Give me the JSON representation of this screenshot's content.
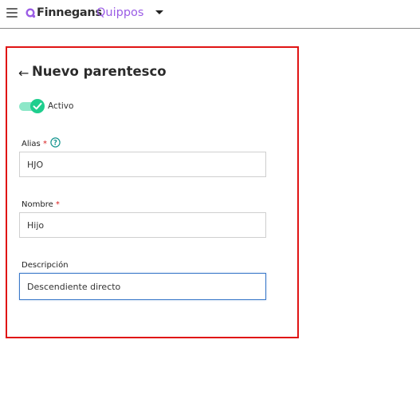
{
  "header": {
    "brand_primary": "Finnegans",
    "brand_secondary": "Quippos",
    "icons": {
      "menu": "hamburger-menu-icon",
      "logo": "finnegans-logo-icon",
      "caret": "caret-down-icon"
    },
    "colors": {
      "brand_secondary": "#9b5de5"
    }
  },
  "form": {
    "title": "Nuevo parentesco",
    "back_icon": "arrow-left-icon",
    "toggle": {
      "label": "Activo",
      "checked": true,
      "color": "#1fce8e"
    },
    "alias": {
      "label": "Alias",
      "required_mark": "*",
      "value": "HJO",
      "help_icon": "help-circle-icon"
    },
    "nombre": {
      "label": "Nombre",
      "required_mark": "*",
      "value": "Hijo"
    },
    "descripcion": {
      "label": "Descripción",
      "value": "Descendiente directo"
    },
    "highlight_color": "#e01414"
  }
}
